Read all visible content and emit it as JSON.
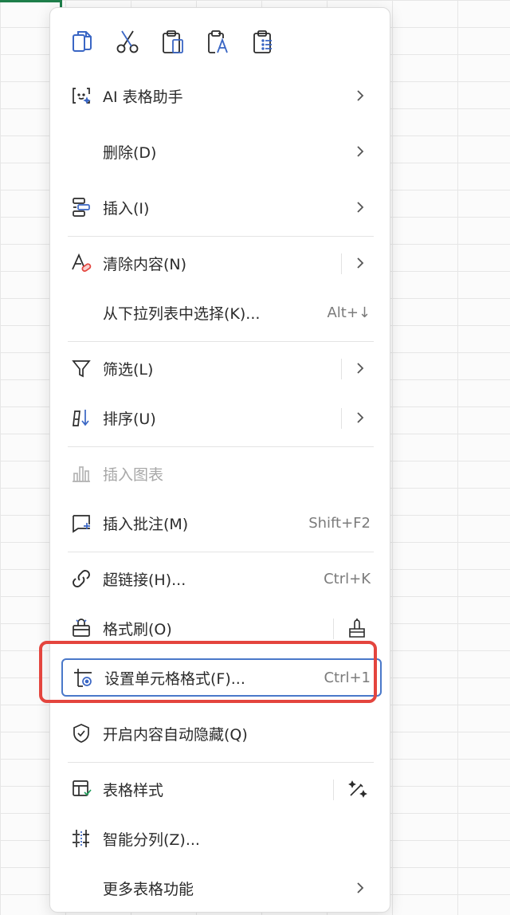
{
  "menu": {
    "clipboard": [
      {
        "name": "copy-icon"
      },
      {
        "name": "cut-icon"
      },
      {
        "name": "paste-icon"
      },
      {
        "name": "paste-text-icon"
      },
      {
        "name": "paste-special-icon"
      }
    ],
    "items": {
      "ai": {
        "label": "AI 表格助手",
        "icon": "ai-assistant-icon"
      },
      "delete": {
        "label": "删除(D)"
      },
      "insert": {
        "label": "插入(I)",
        "icon": "insert-icon"
      },
      "clear": {
        "label": "清除内容(N)",
        "icon": "clear-content-icon"
      },
      "dropdown": {
        "label": "从下拉列表中选择(K)...",
        "shortcut": "Alt+↓"
      },
      "filter": {
        "label": "筛选(L)",
        "icon": "filter-icon"
      },
      "sort": {
        "label": "排序(U)",
        "icon": "sort-icon"
      },
      "chart": {
        "label": "插入图表",
        "icon": "chart-icon",
        "disabled": true
      },
      "comment": {
        "label": "插入批注(M)",
        "icon": "comment-icon",
        "shortcut": "Shift+F2"
      },
      "hyperlink": {
        "label": "超链接(H)...",
        "icon": "link-icon",
        "shortcut": "Ctrl+K"
      },
      "painter": {
        "label": "格式刷(O)",
        "icon": "format-painter-icon",
        "side_icon": "paint-brush-icon"
      },
      "format_cells": {
        "label": "设置单元格格式(F)...",
        "icon": "format-cells-icon",
        "shortcut": "Ctrl+1"
      },
      "auto_hide": {
        "label": "开启内容自动隐藏(Q)",
        "icon": "shield-icon"
      },
      "table_style": {
        "label": "表格样式",
        "icon": "table-style-icon",
        "side_icon": "magic-wand-icon"
      },
      "smart_split": {
        "label": "智能分列(Z)...",
        "icon": "split-column-icon"
      },
      "more": {
        "label": "更多表格功能"
      }
    }
  },
  "colors": {
    "icon_accent": "#3a66c4",
    "highlight": "#e4453e",
    "selected_border": "#4a78c9",
    "cell_selection": "#1e7e4a"
  }
}
